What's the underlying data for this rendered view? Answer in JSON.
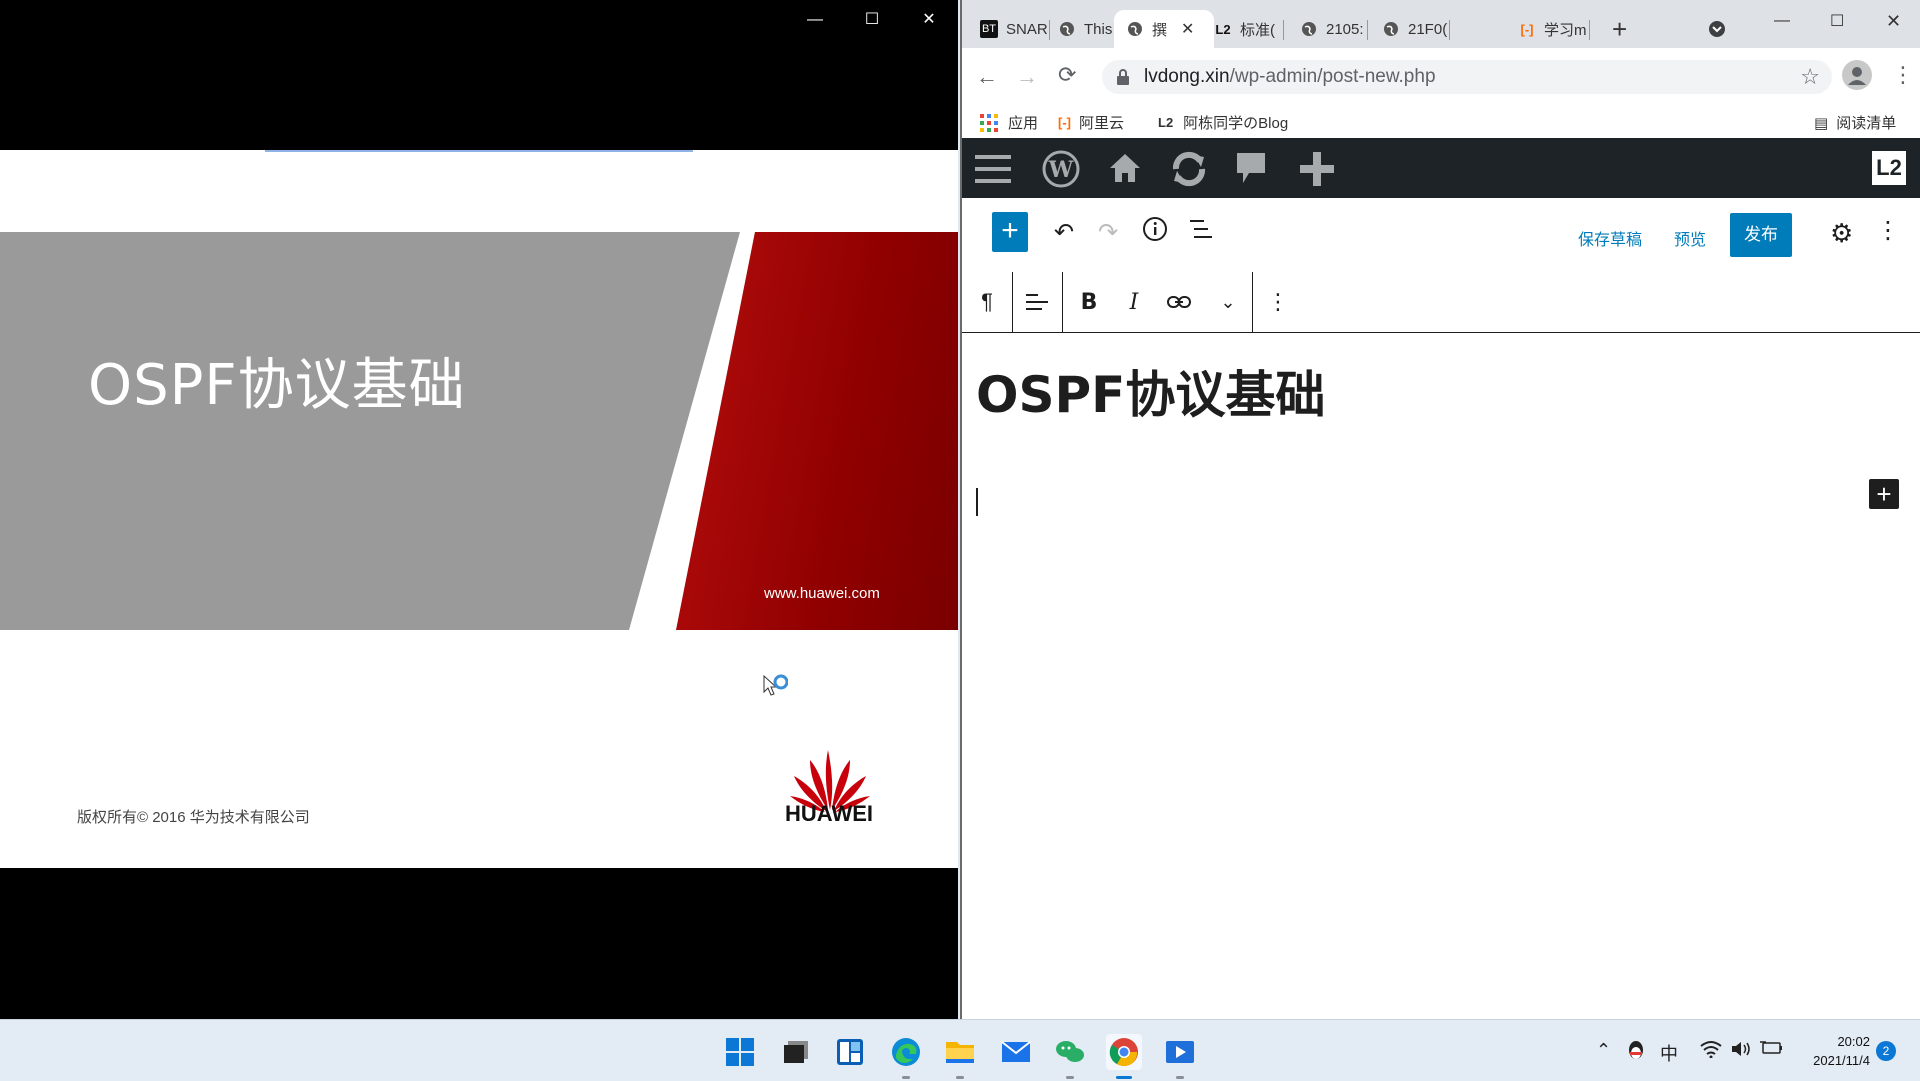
{
  "viewer": {
    "controls": {
      "minimize": "—",
      "maximize": "☐",
      "close": "✕"
    },
    "slide": {
      "title": "OSPF协议基础",
      "url": "www.huawei.com",
      "copyright": "版权所有© 2016 华为技术有限公司",
      "logo_text": "HUAWEI"
    }
  },
  "chrome": {
    "tabs": [
      {
        "icon": "BT",
        "label": "SNAR"
      },
      {
        "icon": "globe",
        "label": "This i"
      },
      {
        "icon": "globe",
        "label": "撰"
      },
      {
        "icon": "L2",
        "label": "标准("
      },
      {
        "icon": "globe",
        "label": "2105:"
      },
      {
        "icon": "globe",
        "label": "21F0("
      },
      {
        "icon": "aliyun",
        "label": "学习m"
      }
    ],
    "new_tab": "+",
    "window_controls": {
      "minimize": "—",
      "maximize": "☐",
      "close": "✕"
    },
    "address": {
      "host": "lvdong.xin",
      "path": "/wp-admin/post-new.php"
    },
    "bookmarks": [
      {
        "label": "应用"
      },
      {
        "label": "阿里云"
      },
      {
        "label": "阿栋同学のBlog"
      }
    ],
    "reading_list": "阅读清单"
  },
  "wp": {
    "editor_toolbar": {
      "save_draft": "保存草稿",
      "preview": "预览",
      "publish": "发布"
    },
    "post_title": "OSPF协议基础",
    "add_block": "+"
  },
  "taskbar": {
    "ime": "中",
    "time": "20:02",
    "date": "2021/11/4",
    "notifications": "2"
  },
  "colors": {
    "wp_blue": "#007cba",
    "wp_admin_bar": "#1d2327",
    "huawei_red": "#c7000b",
    "slide_gray": "#9a9a9a"
  }
}
